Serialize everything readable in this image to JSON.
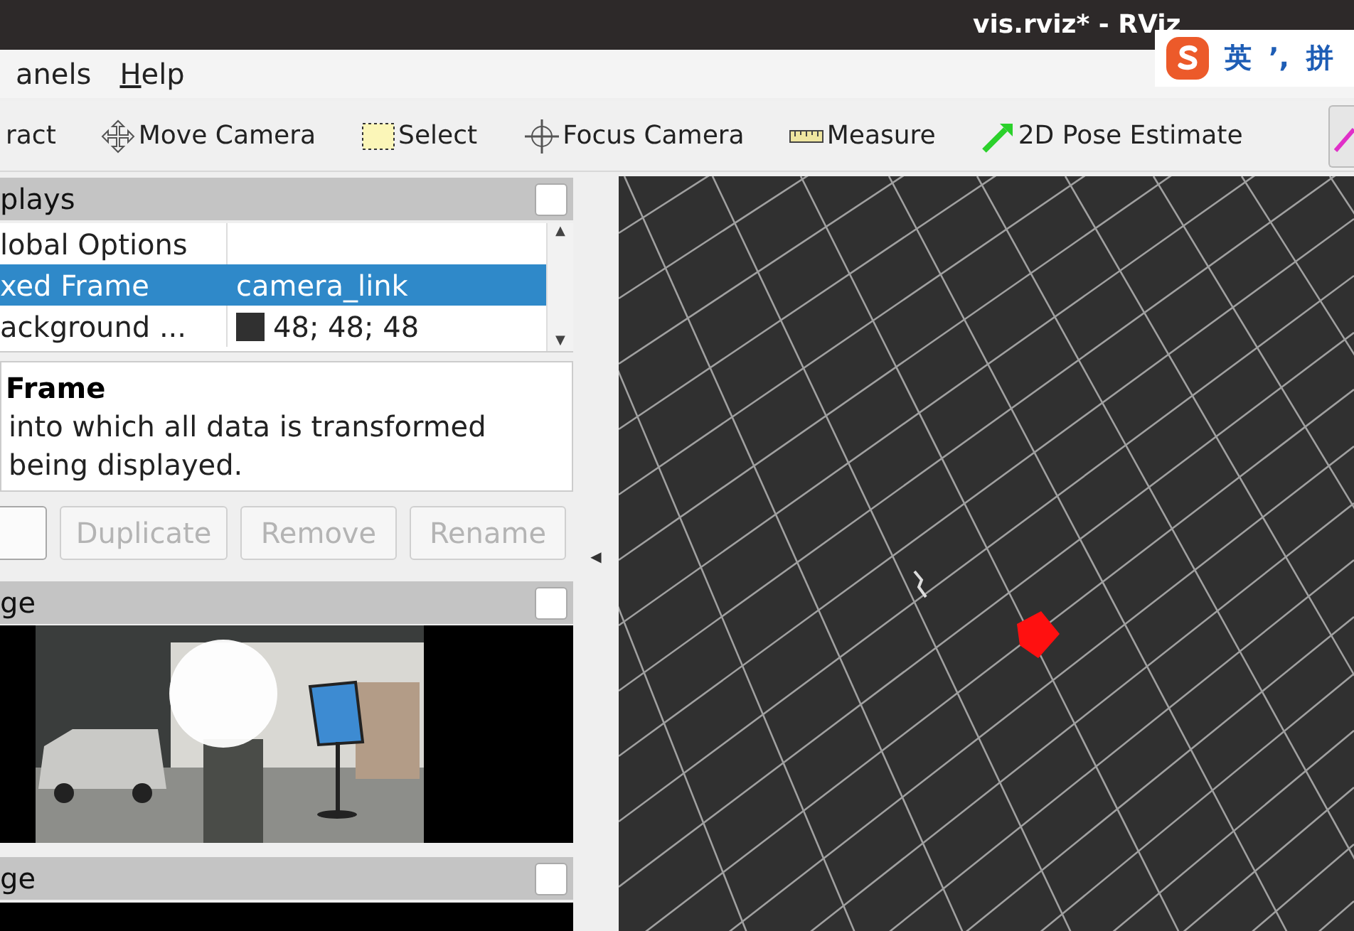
{
  "window": {
    "title": "vis.rviz* - RViz"
  },
  "menu": [
    {
      "label": "anels",
      "underlined": false
    },
    {
      "label": "Help",
      "underlined": true
    }
  ],
  "tree_scroll": {
    "up": "▲",
    "down": "▼"
  },
  "splitter": {
    "handle": "◀"
  },
  "ime_bar": {
    "labels": [
      "英",
      "’,",
      "拼"
    ]
  },
  "toolbar": [
    {
      "label": "ract",
      "kind": "plain"
    },
    {
      "label": "Move Camera",
      "kind": "move"
    },
    {
      "label": "Select",
      "kind": "select"
    },
    {
      "label": "Focus Camera",
      "kind": "focus"
    },
    {
      "label": "Measure",
      "kind": "measure"
    },
    {
      "label": "2D Pose Estimate",
      "kind": "pose"
    },
    {
      "kind": "goal"
    }
  ],
  "displays": {
    "title": "plays",
    "checked": false,
    "rows": [
      {
        "name": "lobal Options",
        "value": "",
        "selected": false
      },
      {
        "name": "xed Frame",
        "value": "camera_link",
        "selected": true
      },
      {
        "name": "ackground ...",
        "value": "48; 48; 48",
        "color": "#303030",
        "selected": false
      }
    ],
    "description": {
      "title": "Frame",
      "text": "into which all data is transformed\nbeing displayed."
    },
    "buttons": [
      {
        "disabled": false
      },
      {
        "label": "Duplicate",
        "disabled": true
      },
      {
        "label": "Remove",
        "disabled": true
      },
      {
        "label": "Rename",
        "disabled": true
      }
    ]
  },
  "image_panels": [
    {
      "title": "ge",
      "checked": false
    },
    {
      "title": "ge",
      "checked": false
    }
  ]
}
